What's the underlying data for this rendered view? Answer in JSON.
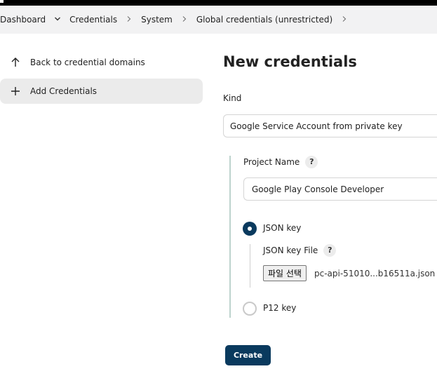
{
  "breadcrumb": {
    "items": [
      "Dashboard",
      "Credentials",
      "System",
      "Global credentials (unrestricted)"
    ]
  },
  "sidebar": {
    "items": [
      {
        "label": "Back to credential domains",
        "icon": "arrow-up-icon"
      },
      {
        "label": "Add Credentials",
        "icon": "plus-icon"
      }
    ]
  },
  "main": {
    "title": "New credentials",
    "kind_label": "Kind",
    "kind_value": "Google Service Account from private key",
    "project_name_label": "Project Name",
    "project_name_value": "Google Play Console Developer",
    "help_glyph": "?",
    "json_key_label": "JSON key",
    "json_key_file_label": "JSON key File",
    "file_button_label": "파일 선택",
    "file_name": "pc-api-51010...b16511a.json",
    "p12_key_label": "P12 key",
    "create_label": "Create",
    "selected_key_type": "JSON key"
  },
  "colors": {
    "accent": "#0a3a5e",
    "breadcrumb_bg": "#f2f2f3",
    "section_line": "#bdd3cd"
  }
}
